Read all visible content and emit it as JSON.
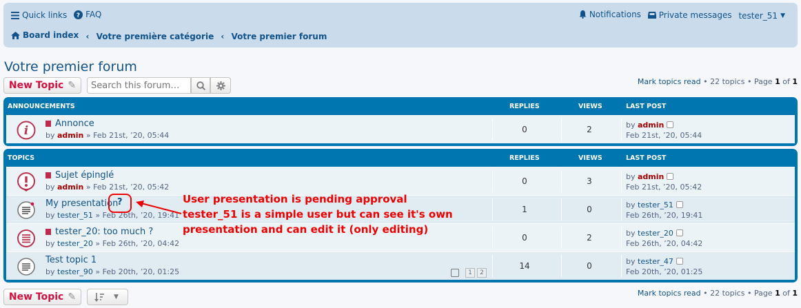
{
  "header": {
    "quick_links": "Quick links",
    "faq": "FAQ",
    "notifications": "Notifications",
    "private_messages": "Private messages",
    "username": "tester_51",
    "breadcrumbs": [
      "Board index",
      "Votre première catégorie",
      "Votre premier forum"
    ]
  },
  "forum_title": "Votre premier forum",
  "toolbar": {
    "new_topic_label": "New Topic",
    "search_placeholder": "Search this forum…",
    "mark_read": "Mark topics read",
    "topics_count": "22 topics",
    "page_word": "Page",
    "page_current": "1",
    "of_word": "of",
    "page_total": "1"
  },
  "announcements": {
    "heading": "Announcements",
    "col_replies": "Replies",
    "col_views": "Views",
    "col_last_post": "Last post",
    "rows": [
      {
        "title": "Annonce",
        "by": "by",
        "author": "admin",
        "date": "» Feb 21st, ’20, 05:44",
        "replies": "0",
        "views": "2",
        "lp_by": "by",
        "lp_author": "admin",
        "lp_date": "Feb 21st, ’20, 05:44"
      }
    ]
  },
  "topics": {
    "heading": "Topics",
    "col_replies": "Replies",
    "col_views": "Views",
    "col_last_post": "Last post",
    "rows": [
      {
        "title": "Sujet épinglé",
        "by": "by",
        "author": "admin",
        "date": "» Feb 21st, ’20, 05:42",
        "replies": "0",
        "views": "3",
        "lp_by": "by",
        "lp_author": "admin",
        "lp_date": "Feb 21st, ’20, 05:42"
      },
      {
        "title": "My presentation",
        "by": "by",
        "author": "tester_51",
        "date": "» Feb 26th, ’20, 19:41",
        "replies": "1",
        "views": "0",
        "lp_by": "by",
        "lp_author": "tester_51",
        "lp_date": "Feb 26th, ’20, 19:41",
        "flag": "?"
      },
      {
        "title": "tester_20: too much ?",
        "by": "by",
        "author": "tester_20",
        "date": "» Feb 26th, ’20, 04:42",
        "replies": "0",
        "views": "2",
        "lp_by": "by",
        "lp_author": "tester_20",
        "lp_date": "Feb 26th, ’20, 04:42"
      },
      {
        "title": "Test topic 1",
        "by": "by",
        "author": "tester_90",
        "date": "» Feb 20th, ’20, 01:25",
        "replies": "14",
        "views": "0",
        "lp_by": "by",
        "lp_author": "tester_47",
        "lp_date": "Feb 20th, ’20, 01:25",
        "pages": [
          "1",
          "2"
        ]
      }
    ]
  },
  "annotation": {
    "line1": "User presentation is pending approval",
    "line2": "tester_51 is a simple user but can see it's own",
    "line3": "presentation and can edit it (only editing)"
  },
  "colors": {
    "accent": "#0076b1",
    "link": "#105289",
    "annotation": "#ee0000",
    "new_topic": "#d31141"
  }
}
